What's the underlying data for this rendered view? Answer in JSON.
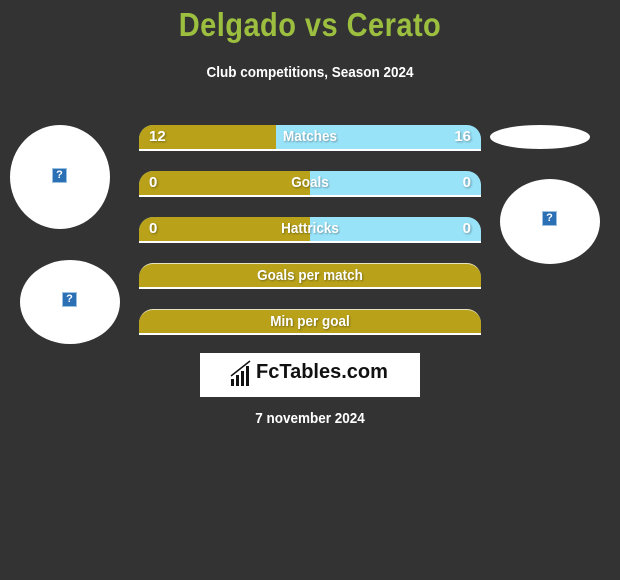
{
  "header": {
    "title": "Delgado vs Cerato",
    "subtitle": "Club competitions, Season 2024"
  },
  "colors": {
    "background": "#333333",
    "title": "#9cbf3f",
    "left_bar": "#b9a21a",
    "right_bar": "#99e3f9"
  },
  "stats": [
    {
      "label": "Matches",
      "left": "12",
      "right": "16",
      "left_fraction": 0.4
    },
    {
      "label": "Goals",
      "left": "0",
      "right": "0",
      "left_fraction": 0.5
    },
    {
      "label": "Hattricks",
      "left": "0",
      "right": "0",
      "left_fraction": 0.5
    },
    {
      "label": "Goals per match"
    },
    {
      "label": "Min per goal"
    }
  ],
  "badges": {
    "left_top_icon": "?",
    "left_bottom_icon": "?",
    "right_icon": "?"
  },
  "logo": {
    "text": "FcTables.com",
    "icon": "bar-chart-icon"
  },
  "date": "7 november 2024"
}
